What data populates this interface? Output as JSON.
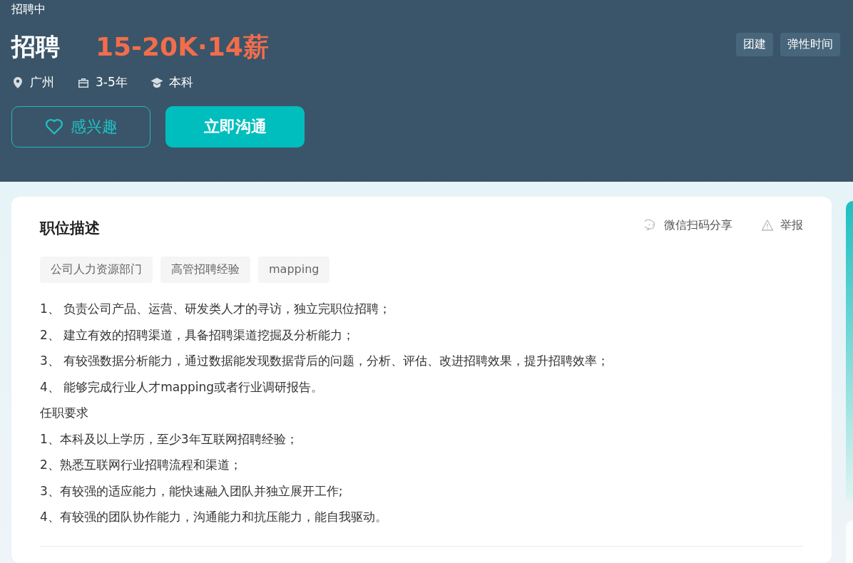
{
  "header": {
    "status": "招聘中",
    "title": "招聘",
    "salary": "15-20K·14薪",
    "benefits": [
      "团建",
      "弹性时间"
    ],
    "meta": [
      {
        "kind": "location",
        "text": "广州"
      },
      {
        "kind": "experience",
        "text": "3-5年"
      },
      {
        "kind": "degree",
        "text": "本科"
      }
    ],
    "buttons": [
      {
        "kind": "interest",
        "label": "感兴趣"
      },
      {
        "kind": "chat",
        "label": "立即沟通"
      }
    ]
  },
  "description": {
    "title": "职位描述",
    "actions": [
      {
        "kind": "share",
        "label": "微信扫码分享"
      },
      {
        "kind": "report",
        "label": "举报"
      }
    ],
    "tags": [
      "公司人力资源部门",
      "高管招聘经验",
      "mapping"
    ],
    "lines": [
      "1、 负责公司产品、运营、研发类人才的寻访，独立完职位招聘；",
      "2、 建立有效的招聘渠道，具备招聘渠道挖掘及分析能力；",
      "3、 有较强数据分析能力，通过数据能发现数据背后的问题，分析、评估、改进招聘效果，提升招聘效率；",
      "4、 能够完成行业人才mapping或者行业调研报告。",
      "任职要求",
      "1、本科及以上学历，至少3年互联网招聘经验；",
      "2、熟悉互联网行业招聘流程和渠道；",
      "3、有较强的适应能力，能快速融入团队并独立展开工作;",
      "4、有较强的团队协作能力，沟通能力和抗压能力，能自我驱动。"
    ]
  }
}
